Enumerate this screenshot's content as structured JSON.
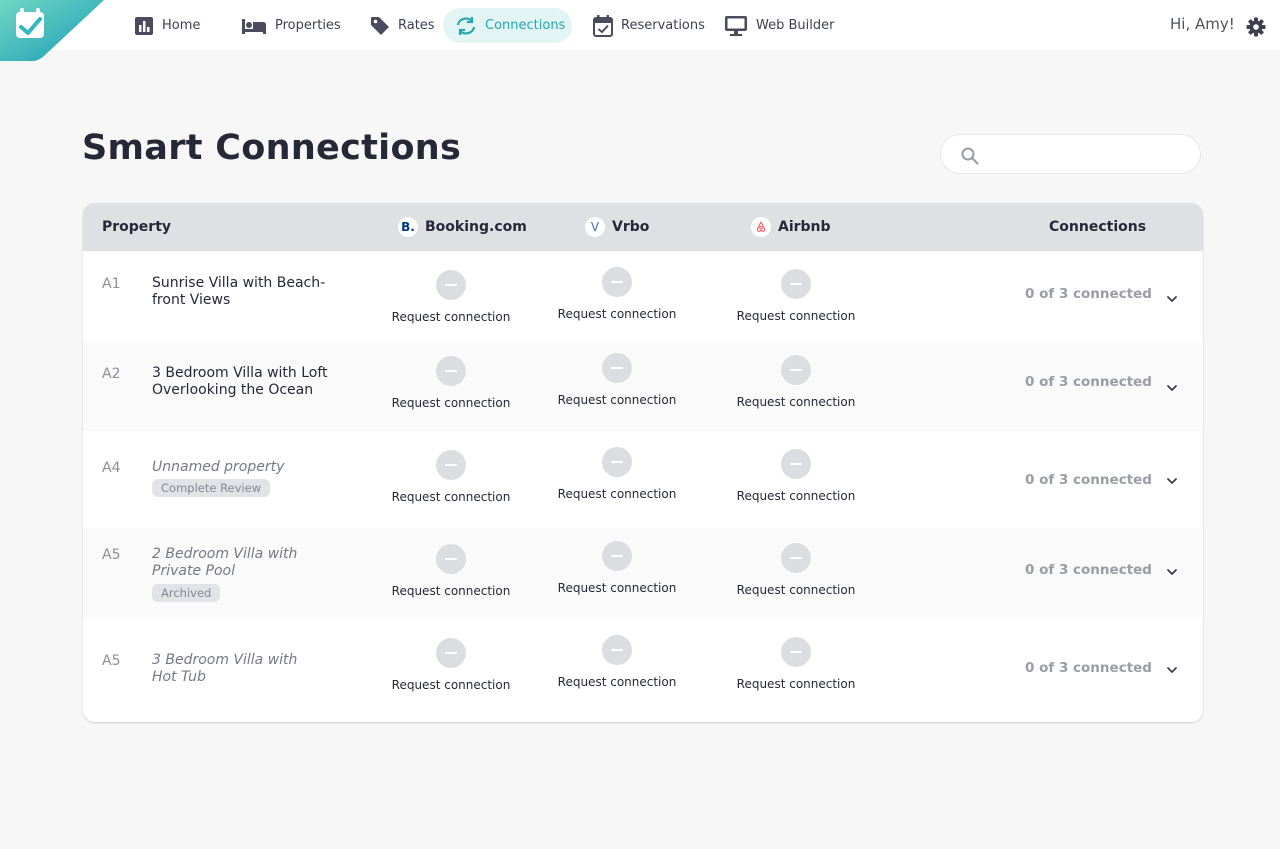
{
  "nav": {
    "items": [
      {
        "label": "Home",
        "icon": "bar-chart-icon"
      },
      {
        "label": "Properties",
        "icon": "bed-icon"
      },
      {
        "label": "Rates",
        "icon": "tag-icon"
      },
      {
        "label": "Connections",
        "icon": "sync-icon",
        "active": true
      },
      {
        "label": "Reservations",
        "icon": "calendar-check-icon"
      },
      {
        "label": "Web Builder",
        "icon": "monitor-icon"
      }
    ],
    "greeting": "Hi, Amy!"
  },
  "page": {
    "title": "Smart Connections",
    "search_placeholder": ""
  },
  "table": {
    "columns": {
      "property": "Property",
      "channel_1": "Booking.com",
      "channel_1_mark": "B.",
      "channel_2": "Vrbo",
      "channel_2_mark": "V",
      "channel_3": "Airbnb",
      "connections": "Connections"
    },
    "action_label": "Request connection",
    "rows": [
      {
        "code": "A1",
        "name": "Sunrise Villa with Beach-front Views",
        "badge": "",
        "connections": "0 of 3 connected"
      },
      {
        "code": "A2",
        "name": "3 Bedroom Villa with Loft Overlooking the Ocean",
        "badge": "",
        "connections": "0 of 3 connected"
      },
      {
        "code": "A4",
        "name": "Unnamed property",
        "badge": "Complete Review",
        "connections": "0 of 3 connected"
      },
      {
        "code": "A5",
        "name": "2 Bedroom Villa with Private Pool",
        "badge": "Archived",
        "connections": "0 of 3 connected"
      },
      {
        "code": "A5",
        "name": "3 Bedroom Villa with Hot Tub",
        "badge": "",
        "connections": "0 of 3 connected"
      }
    ]
  },
  "colors": {
    "accent": "#25a6b0",
    "nav_active_bg": "#e3f4f5",
    "booking_blue": "#003580",
    "airbnb_red": "#ff5a5f",
    "vrbo_blue": "#4a6fa5"
  }
}
